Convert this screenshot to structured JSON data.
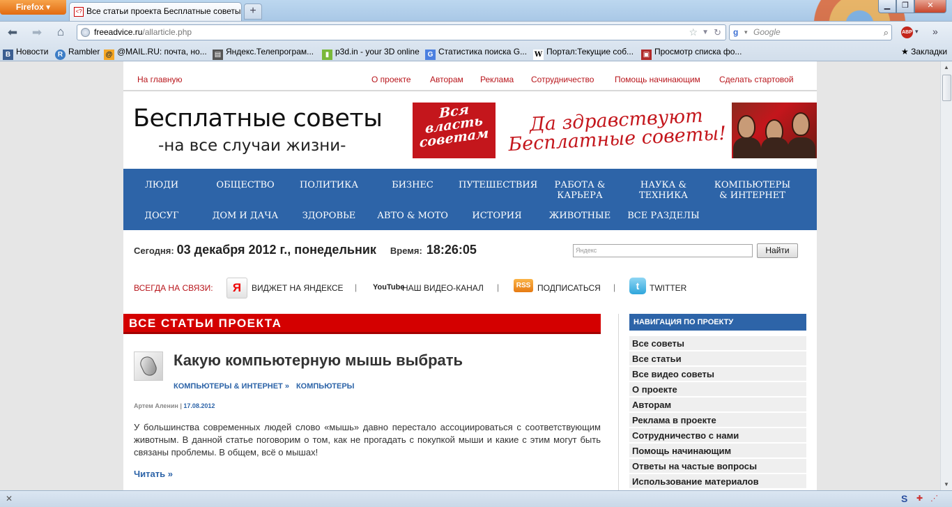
{
  "browser": {
    "app_button": "Firefox",
    "tab_title": "Все статьи проекта Бесплатные советы",
    "tab_favicon": "<?",
    "new_tab": "+",
    "url_domain": "freeadvice.ru",
    "url_path": "/allarticle.php",
    "search_placeholder": "Google",
    "search_engine_icon": "google-icon",
    "adblock_label": "ABP",
    "bookmarks": [
      {
        "label": "Новости",
        "icon": "B",
        "color": "#3b5e91"
      },
      {
        "label": "Rambler",
        "icon": "R",
        "color": "#3c7dc6"
      },
      {
        "label": "@MAIL.RU: почта, но...",
        "icon": "@",
        "color": "#f5a623"
      },
      {
        "label": "Яндекс.Телепрограм...",
        "icon": "▤",
        "color": "#555555"
      },
      {
        "label": "p3d.in - your 3D online",
        "icon": "▮",
        "color": "#7ab83a"
      },
      {
        "label": "Статистика поиска G...",
        "icon": "G",
        "color": "#4a7fe0"
      },
      {
        "label": "Портал:Текущие соб...",
        "icon": "W",
        "color": "#ffffff"
      },
      {
        "label": "Просмотр списка фо...",
        "icon": "▣",
        "color": "#b02a2a"
      }
    ],
    "bookmarks_menu": "Закладки"
  },
  "page": {
    "topnav_home": "На главную",
    "topnav": [
      "О проекте",
      "Авторам",
      "Реклама",
      "Сотрудничество",
      "Помощь начинающим",
      "Сделать стартовой"
    ],
    "logo_title": "Бесплатные советы",
    "logo_subtitle": "-на все случаи жизни-",
    "banner_left": [
      "Вся",
      "власть",
      "советам"
    ],
    "banner_text_1": "Да здравствуют",
    "banner_text_2": "Бесплатные советы!",
    "categories_row1": [
      "ЛЮДИ",
      "ОБЩЕСТВО",
      "ПОЛИТИКА",
      "БИЗНЕС",
      "ПУТЕШЕСТВИЯ",
      "РАБОТА & КАРЬЕРА",
      "НАУКА & ТЕХНИКА",
      "КОМПЬЮТЕРЫ & ИНТЕРНЕТ"
    ],
    "categories_row2": [
      "ДОСУГ",
      "ДОМ И ДАЧА",
      "ЗДОРОВЬЕ",
      "АВТО & МОТО",
      "ИСТОРИЯ",
      "ЖИВОТНЫЕ",
      "ВСЕ РАЗДЕЛЫ"
    ],
    "today_label": "Сегодня:",
    "today_date": "03 декабря 2012 г., понедельник",
    "time_label": "Время:",
    "time_value": "18:26:05",
    "yandex_placeholder": "Яндекс",
    "search_button": "Найти",
    "social_label": "ВСЕГДА НА СВЯЗИ:",
    "social_items": [
      "ВИДЖЕТ НА ЯНДЕКСЕ",
      "НАШ ВИДЕО-КАНАЛ",
      "ПОДПИСАТЬСЯ",
      "TWITTER"
    ],
    "social_sep": "|",
    "youtube_logo": "YouTube",
    "rss_logo": "RSS",
    "section_title": "ВСЕ СТАТЬИ ПРОЕКТА",
    "article": {
      "title": "Какую компьютерную мышь выбрать",
      "category_1": "КОМПЬЮТЕРЫ & ИНТЕРНЕТ »",
      "category_2": "КОМПЬЮТЕРЫ",
      "author": "Артем Аленин",
      "meta_sep": " | ",
      "date": "17.08.2012",
      "text": "У большинства современных людей слово «мышь» давно перестало ассоциироваться с соответствующим животным. В данной статье поговорим о том, как не прогадать с покупкой мыши и какие с этим могут быть связаны проблемы. В общем, всё о мышах!",
      "read_more": "Читать »"
    },
    "sidebar_title": "НАВИГАЦИЯ ПО ПРОЕКТУ",
    "sidebar_items": [
      "Все советы",
      "Все статьи",
      "Все видео советы",
      "О проекте",
      "Авторам",
      "Реклама в проекте",
      "Сотрудничество с нами",
      "Помощь начинающим",
      "Ответы на частые вопросы",
      "Использование материалов"
    ]
  },
  "colors": {
    "accent_red": "#d40000",
    "nav_blue": "#2d64a8",
    "link_red": "#b8151b"
  }
}
